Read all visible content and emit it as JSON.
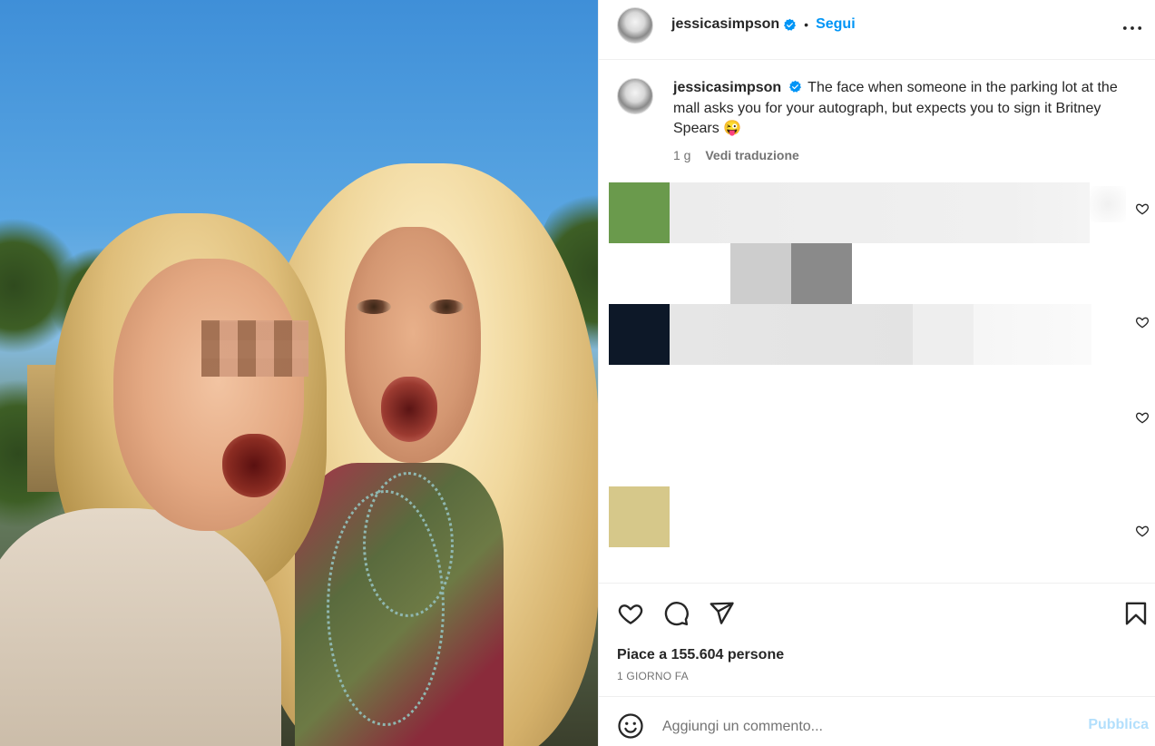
{
  "post": {
    "username": "jessicasimpson",
    "follow_label": "Segui",
    "separator": "•",
    "caption": "The face when someone in the parking lot at the mall asks you for your autograph, but expects you to sign it Britney Spears 😜",
    "time_ago": "1 g",
    "translate_label": "Vedi traduzione",
    "likes_text": "Piace a 155.604 persone",
    "date_text": "1 GIORNO FA"
  },
  "comment_box": {
    "placeholder": "Aggiungi un commento...",
    "publish_label": "Pubblica"
  },
  "colors": {
    "accent": "#0095f6",
    "publish_disabled": "#b2dffc",
    "verified": "#0095f6",
    "pixel_green": "#6a9a4c",
    "pixel_navy": "#0d1828",
    "pixel_khaki": "#d6c88a"
  },
  "icons": {
    "more": "more-horizontal-icon",
    "verified": "verified-badge-icon",
    "like": "heart-icon",
    "comment": "comment-icon",
    "share": "share-icon",
    "save": "bookmark-icon",
    "emoji": "emoji-icon"
  }
}
